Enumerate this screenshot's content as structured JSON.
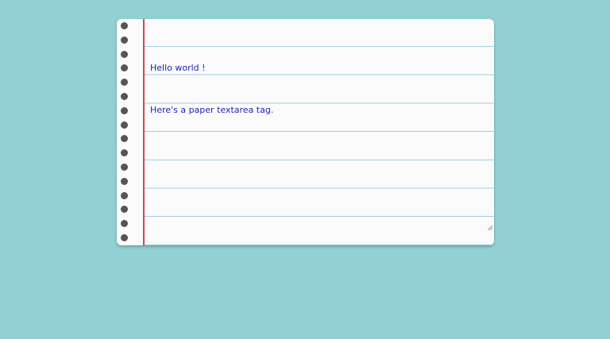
{
  "background_color": "#92d1d3",
  "paper": {
    "background_color": "#fbfbfb",
    "margin_line_color": "#d8444a",
    "rule_line_color": "#9fcfdb",
    "text_color": "#2222bb",
    "text_lines": [
      "Hello world !",
      "Here's a paper textarea tag."
    ]
  }
}
